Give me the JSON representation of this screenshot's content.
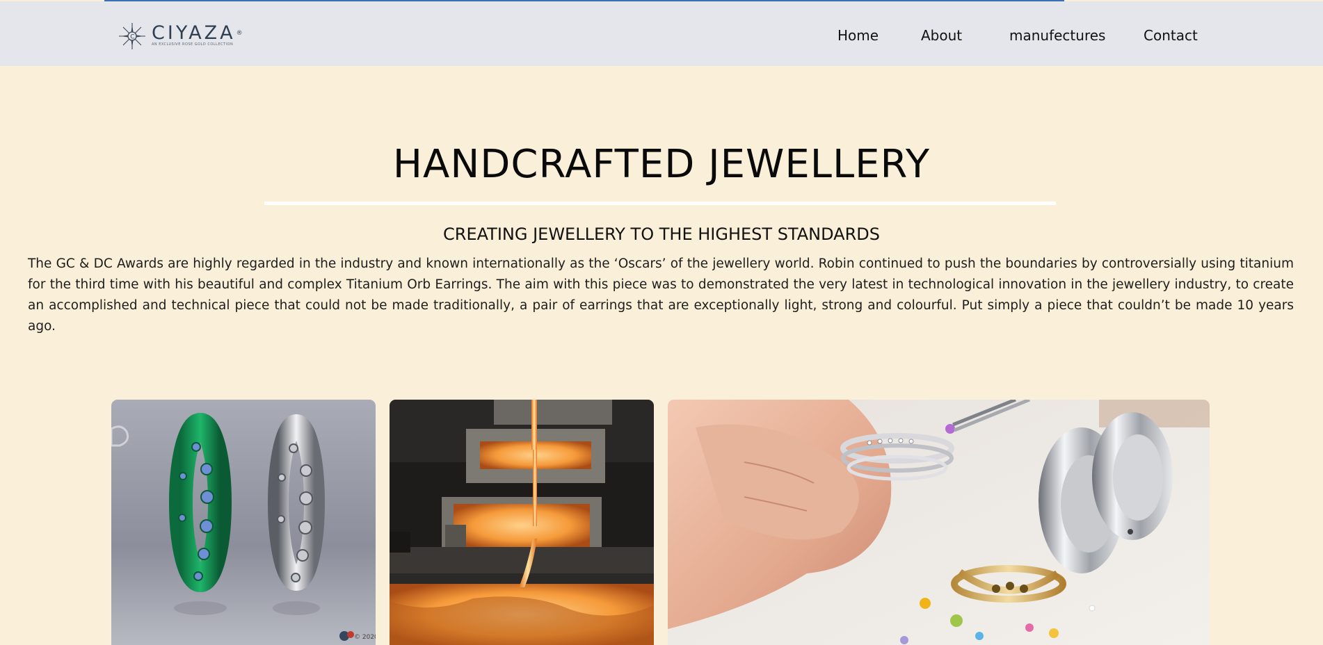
{
  "brand": {
    "name": "CIYAZA",
    "registered": "®",
    "tagline": "AN EXCLUSIVE ROSE GOLD COLLECTION"
  },
  "nav": {
    "items": [
      "Home",
      "About",
      "manufectures",
      "Contact"
    ]
  },
  "hero": {
    "title": "HANDCRAFTED JEWELLERY",
    "subtitle": "CREATING JEWELLERY TO THE HIGHEST STANDARDS",
    "body": "The GC & DC Awards are highly regarded in the industry and known internationally as the ‘Oscars’ of the jewellery world. Robin continued to push the boundaries by controversially using titanium for the third time with his beautiful and complex Titanium Orb Earrings. The aim with this piece was to demonstrated the very latest in technological innovation in the jewellery industry, to create an accomplished and technical piece that could not be made traditionally, a pair of earrings that are exceptionally light, strong and colourful. Put simply a piece that couldn’t be made 10 years ago."
  },
  "gallery": {
    "images": [
      {
        "icon": "green-and-silver-eternity-rings-photo",
        "caption": "© 2020"
      },
      {
        "icon": "molten-metal-casting-photo"
      },
      {
        "icon": "jeweller-setting-gemstones-photo"
      }
    ]
  },
  "colors": {
    "page_background": "#faefd8",
    "navbar_background": "#e5e6eb",
    "brand_text": "#2f3f52",
    "divider": "#ffffff"
  }
}
